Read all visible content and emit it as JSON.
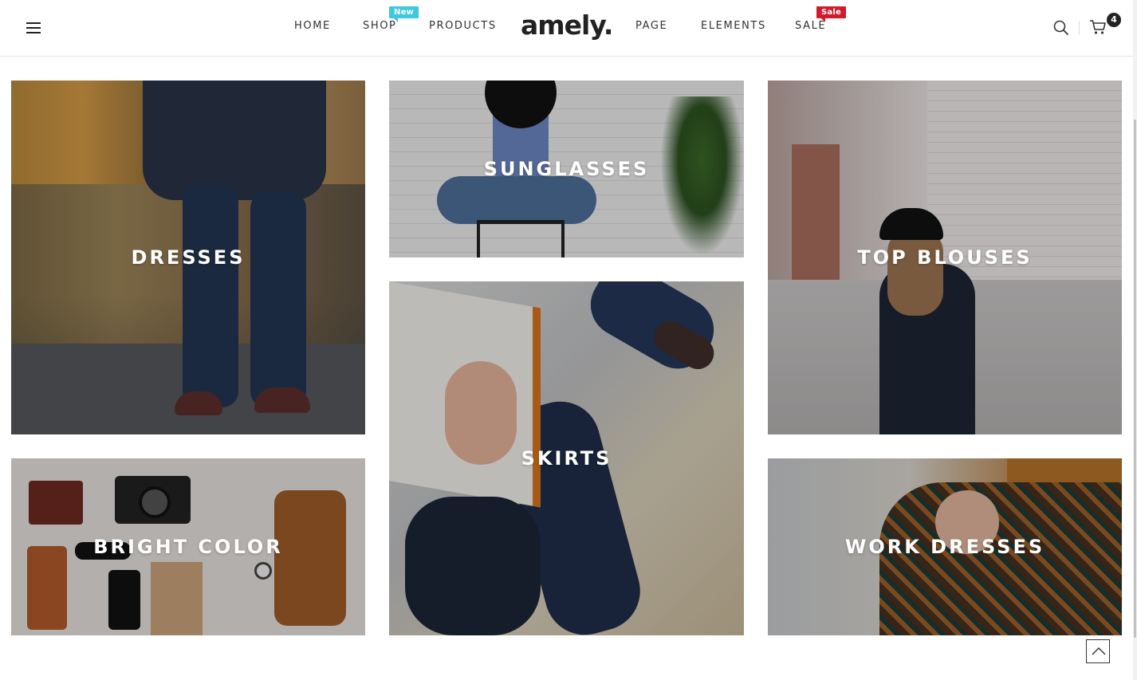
{
  "header": {
    "logo": "amely.",
    "nav": {
      "home": "HOME",
      "shop": "SHOP",
      "shop_badge": "New",
      "products": "PRODUCTS",
      "page": "PAGE",
      "elements": "ELEMENTS",
      "sale": "SALE",
      "sale_badge": "Sale"
    },
    "cart_count": "4",
    "icons": {
      "menu": "hamburger-icon",
      "search": "search-icon",
      "cart": "cart-icon"
    }
  },
  "categories": {
    "dresses": "DRESSES",
    "sunglasses": "SUNGLASSES",
    "top_blouses": "TOP BLOUSES",
    "bright_color": "BRIGHT COLOR",
    "skirts": "SKIRTS",
    "work_dresses": "WORK DRESSES"
  },
  "colors": {
    "badge_new": "#3fc7de",
    "badge_sale": "#d11a2a",
    "text_dark": "#222222"
  },
  "back_to_top_icon": "chevron-up-icon"
}
